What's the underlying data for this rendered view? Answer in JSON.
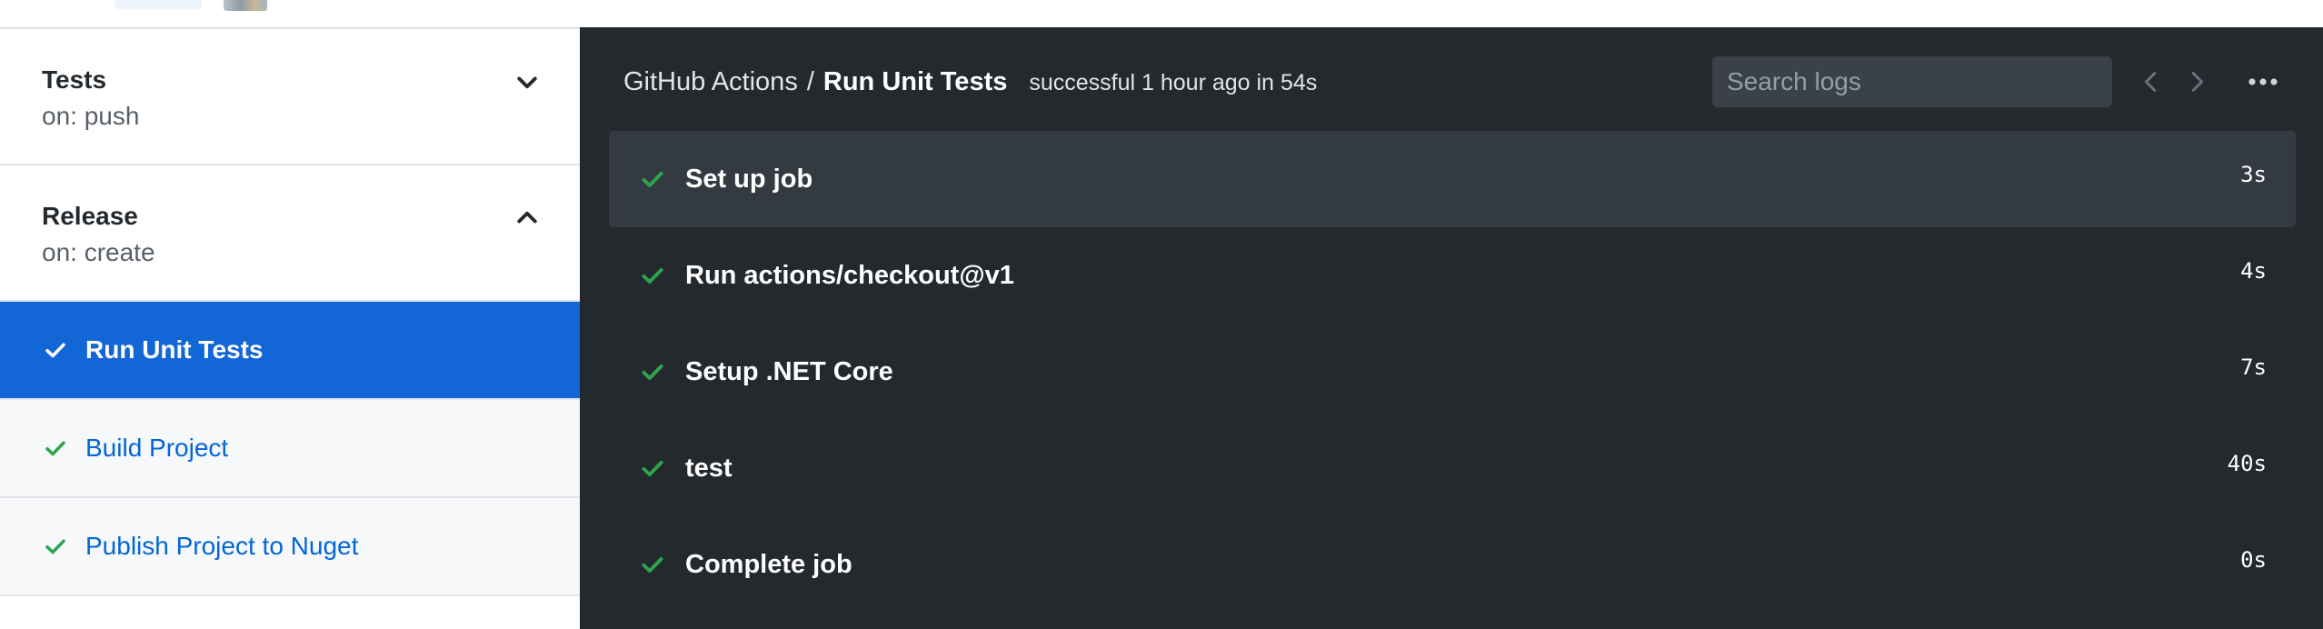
{
  "sidebar": {
    "workflows": [
      {
        "name": "Tests",
        "trigger": "on: push",
        "expanded": false
      },
      {
        "name": "Release",
        "trigger": "on: create",
        "expanded": true
      }
    ],
    "jobs": [
      {
        "label": "Run Unit Tests",
        "status": "success",
        "active": true
      },
      {
        "label": "Build Project",
        "status": "success",
        "active": false
      },
      {
        "label": "Publish Project to Nuget",
        "status": "success",
        "active": false
      }
    ]
  },
  "header": {
    "workflow": "GitHub Actions",
    "separator": "/",
    "job": "Run Unit Tests",
    "status": "successful 1 hour ago in 54s"
  },
  "search": {
    "placeholder": "Search logs",
    "value": ""
  },
  "steps": [
    {
      "name": "Set up job",
      "duration": "3s",
      "status": "success"
    },
    {
      "name": "Run actions/checkout@v1",
      "duration": "4s",
      "status": "success"
    },
    {
      "name": "Setup .NET Core",
      "duration": "7s",
      "status": "success"
    },
    {
      "name": "test",
      "duration": "40s",
      "status": "success"
    },
    {
      "name": "Complete job",
      "duration": "0s",
      "status": "success"
    }
  ],
  "colors": {
    "success": "#2ea44f",
    "active_bg": "#1366d6",
    "log_bg": "#24292e",
    "link": "#0366d6"
  },
  "icons": {
    "step_status": "check-icon",
    "collapse": "chevron-down-icon",
    "expand": "chevron-up-icon",
    "prev": "chevron-left-icon",
    "next": "chevron-right-icon",
    "more": "kebab-horizontal-icon"
  }
}
